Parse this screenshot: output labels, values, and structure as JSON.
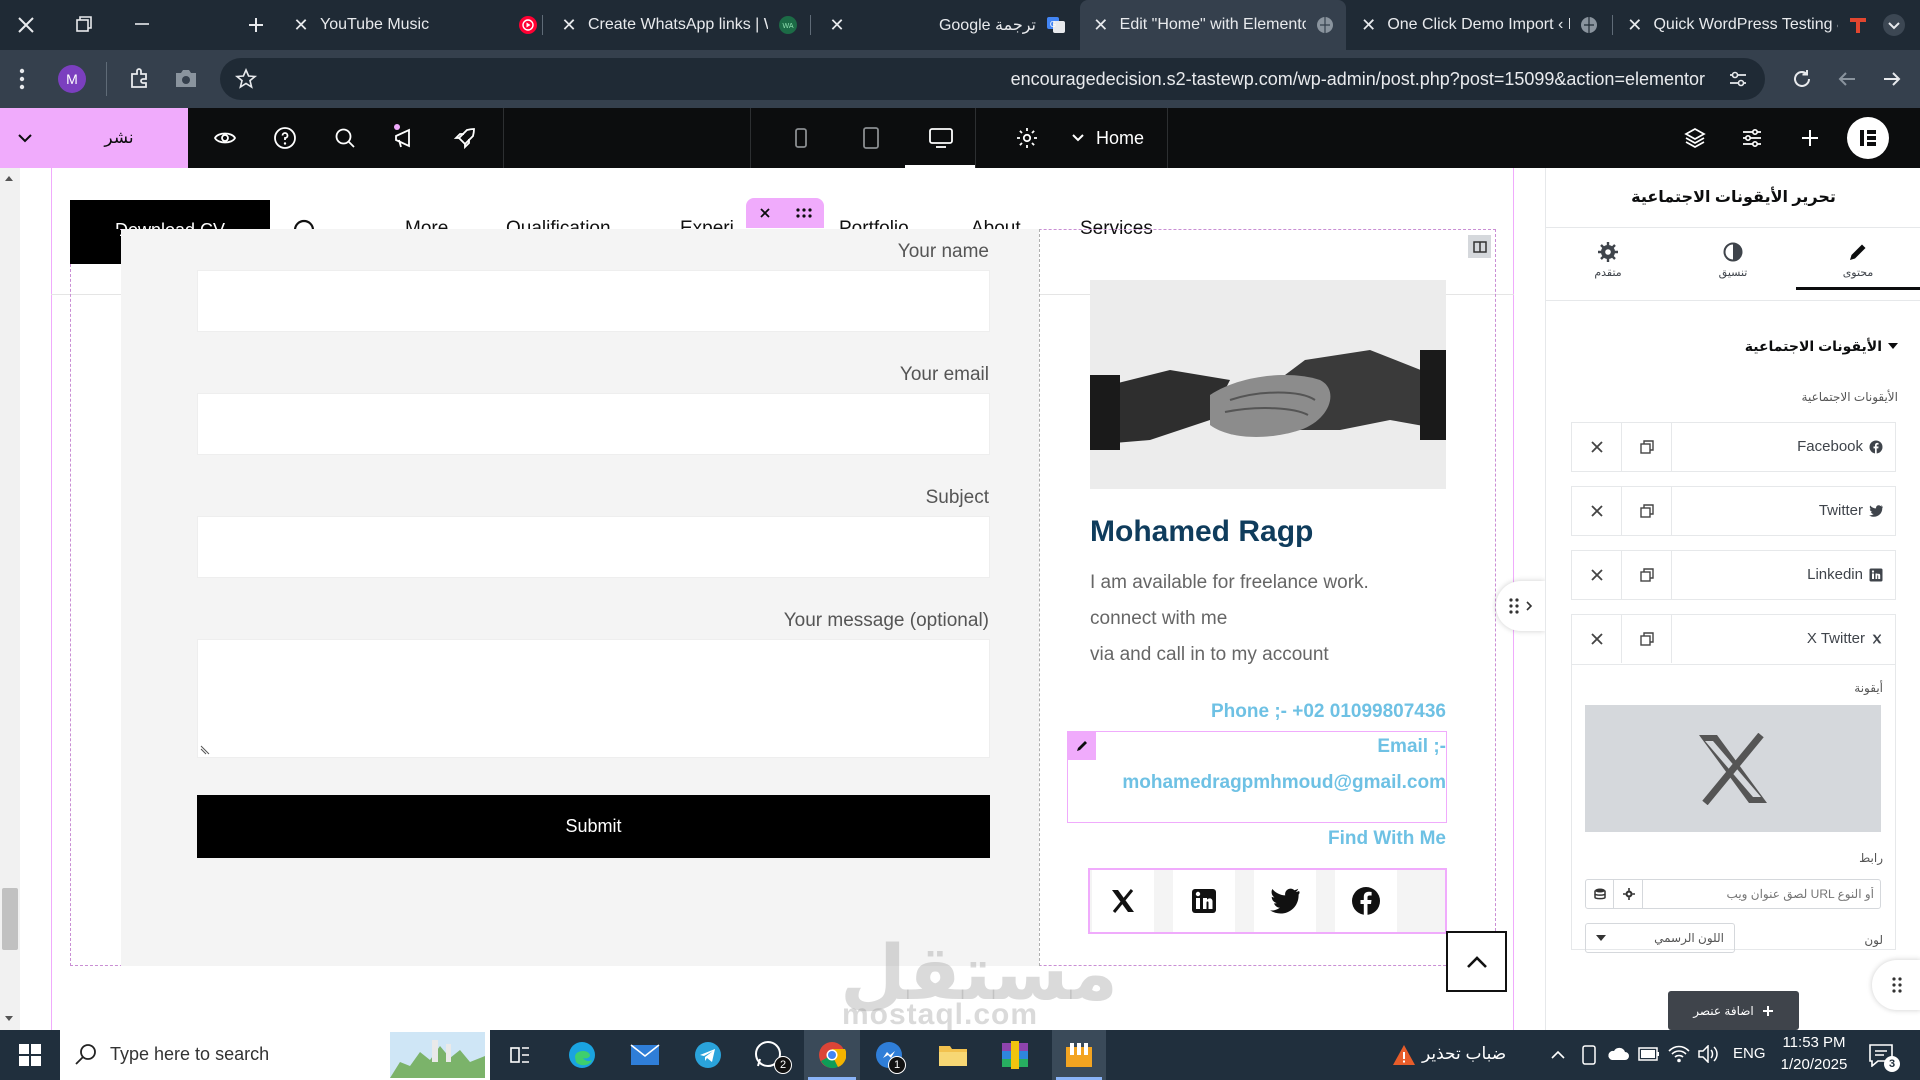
{
  "browser": {
    "tabs": [
      {
        "title": "YouTube Music"
      },
      {
        "title": "Create WhatsApp links | W"
      },
      {
        "title": "Google ترجمة"
      },
      {
        "title": "Edit \"Home\" with Elementor"
      },
      {
        "title": "One Click Demo Import ‹ E"
      },
      {
        "title": "Quick WordPress Testing &"
      }
    ],
    "profile_letter": "M",
    "url": "encouragedecision.s2-tastewp.com/wp-admin/post.php?post=15099&action=elementor"
  },
  "elementor": {
    "publish_label": "نشر",
    "page_name": "Home",
    "logo_letter": "E"
  },
  "site": {
    "download_cv": "Download CV",
    "nav": [
      "More",
      "Qualification",
      "Experi",
      "Portfolio",
      "About",
      "Services"
    ],
    "form": {
      "name_label": "Your name",
      "email_label": "Your email",
      "subject_label": "Subject",
      "message_label": "Your message (optional)",
      "submit_label": "Submit"
    },
    "profile": {
      "name": "Mohamed Ragp",
      "bio_line1": "I am available for freelance work.",
      "bio_line2": "connect with me",
      "bio_line3": "via and call in to my account",
      "phone": "Phone ;- +02 01099807436",
      "email_label": "Email ;-",
      "email": "mohamedragpmhmoud@gmail.com",
      "find_label": "Find With Me"
    },
    "social_icons": [
      "x-icon",
      "linkedin-icon",
      "twitter-icon",
      "facebook-icon"
    ],
    "watermark": "مستقل",
    "watermark_sub": "mostaql.com"
  },
  "panel": {
    "title": "تحرير الأيقونات الاجتماعية",
    "tabs": [
      {
        "label": "محتوى",
        "icon": "pencil-icon"
      },
      {
        "label": "تنسيق",
        "icon": "contrast-icon"
      },
      {
        "label": "متقدم",
        "icon": "gear-icon"
      }
    ],
    "section_title": "الأيقونات الاجتماعية",
    "list_label": "الأيقونات الاجتماعية",
    "items": [
      {
        "label": "Facebook",
        "icon": "facebook-icon"
      },
      {
        "label": "Twitter",
        "icon": "twitter-icon"
      },
      {
        "label": "Linkedin",
        "icon": "linkedin-icon"
      },
      {
        "label": "X Twitter",
        "icon": "x-icon"
      }
    ],
    "icon_label": "أيقونة",
    "link_label": "رابط",
    "link_placeholder": "لصق عنوان ويب URL أو النوع",
    "color_label": "لون",
    "color_value": "اللون الرسمي",
    "add_item_label": "اضافة عنصر"
  },
  "taskbar": {
    "search_placeholder": "Type here to search",
    "weather": "ضباب تحذير",
    "lang": "ENG",
    "time": "11:53 PM",
    "date": "1/20/2025",
    "whatsapp_badge": "2",
    "messenger_badge": "1",
    "notifications": "3"
  },
  "colors": {
    "accent_pink": "#f0abfc",
    "link_blue": "#6ec1e4",
    "name_color": "#0f3c5c"
  }
}
